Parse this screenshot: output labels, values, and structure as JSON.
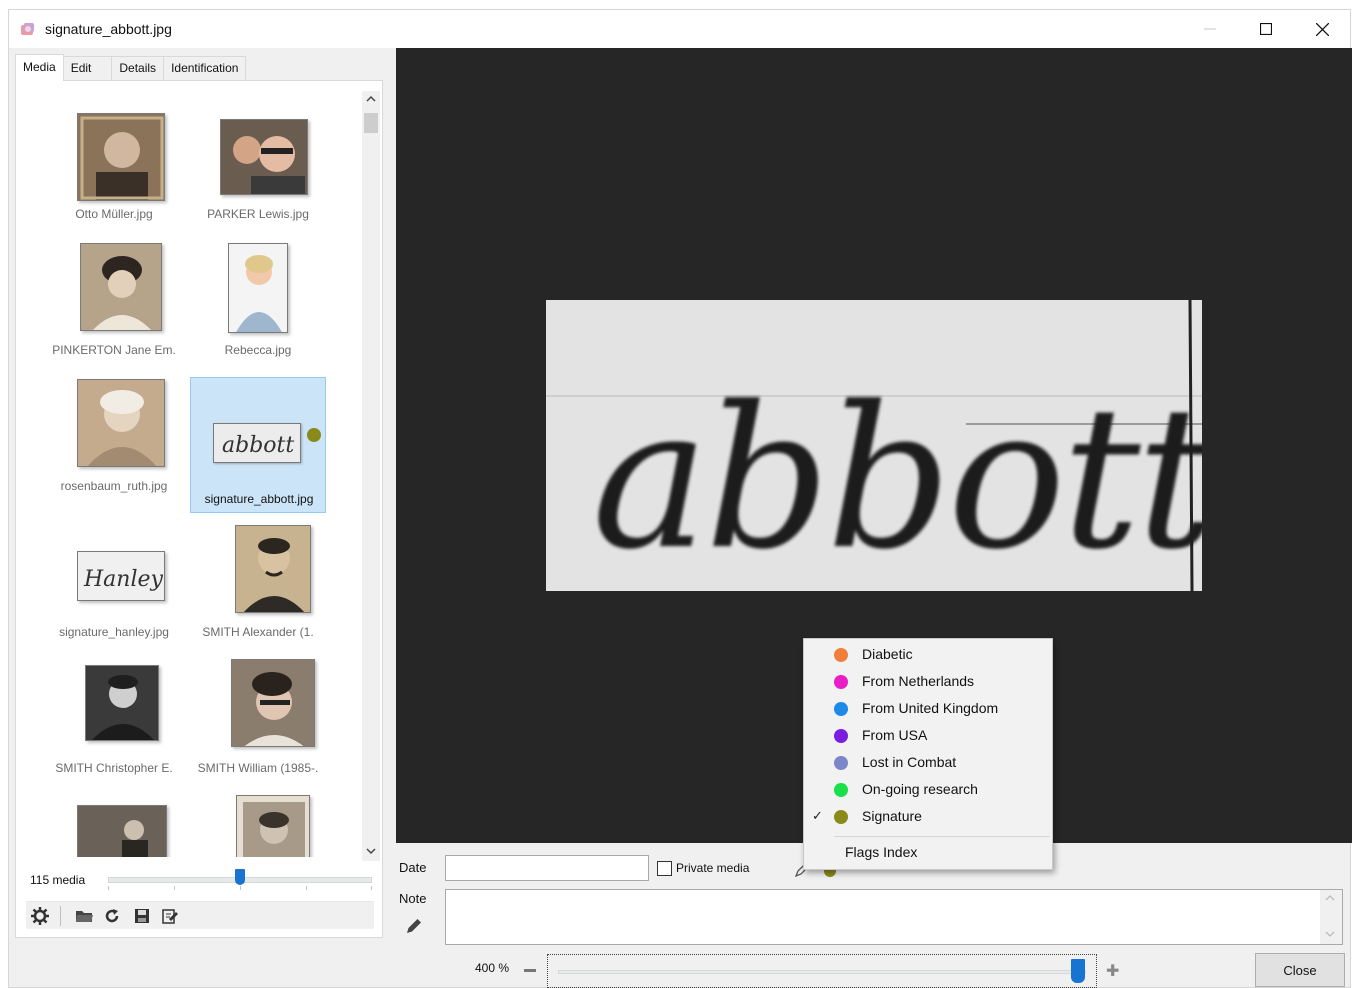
{
  "window": {
    "title": "signature_abbott.jpg"
  },
  "tabs": [
    {
      "label": "Media",
      "active": true
    },
    {
      "label": "Edit",
      "active": false
    },
    {
      "label": "Details",
      "active": false
    },
    {
      "label": "Identification",
      "active": false
    }
  ],
  "thumbnails": [
    {
      "label": "Otto Müller.jpg"
    },
    {
      "label": "PARKER Lewis.jpg"
    },
    {
      "label": "PINKERTON Jane Em."
    },
    {
      "label": "Rebecca.jpg"
    },
    {
      "label": "rosenbaum_ruth.jpg"
    },
    {
      "label": "signature_abbott.jpg",
      "selected": true,
      "flag_color": "#8a8a1a"
    },
    {
      "label": "signature_hanley.jpg"
    },
    {
      "label": "SMITH Alexander (1."
    },
    {
      "label": "SMITH Christopher E."
    },
    {
      "label": "SMITH William (1985-."
    }
  ],
  "media_count": "115 media",
  "thumb_size_level": 0.5,
  "toolbar_icons": [
    "gear-icon",
    "folder-open-icon",
    "refresh-icon",
    "save-icon",
    "edit-document-icon"
  ],
  "signature_text": "abbott",
  "date": {
    "label": "Date",
    "value": ""
  },
  "private_media": {
    "label": "Private media",
    "checked": false
  },
  "note": {
    "label": "Note",
    "value": ""
  },
  "zoom": {
    "label": "400 %",
    "level": 1.0
  },
  "close_button": "Close",
  "flags_menu": {
    "items": [
      {
        "label": "Diabetic",
        "color": "#f07f3c",
        "checked": false
      },
      {
        "label": "From Netherlands",
        "color": "#e91ec4",
        "checked": false
      },
      {
        "label": "From United Kingdom",
        "color": "#1c8ae6",
        "checked": false
      },
      {
        "label": "From USA",
        "color": "#7a1fe0",
        "checked": false
      },
      {
        "label": "Lost in Combat",
        "color": "#7d86c8",
        "checked": false
      },
      {
        "label": "On-going research",
        "color": "#19e04a",
        "checked": false
      },
      {
        "label": "Signature",
        "color": "#8a8a1a",
        "checked": true
      }
    ],
    "index_label": "Flags Index"
  }
}
